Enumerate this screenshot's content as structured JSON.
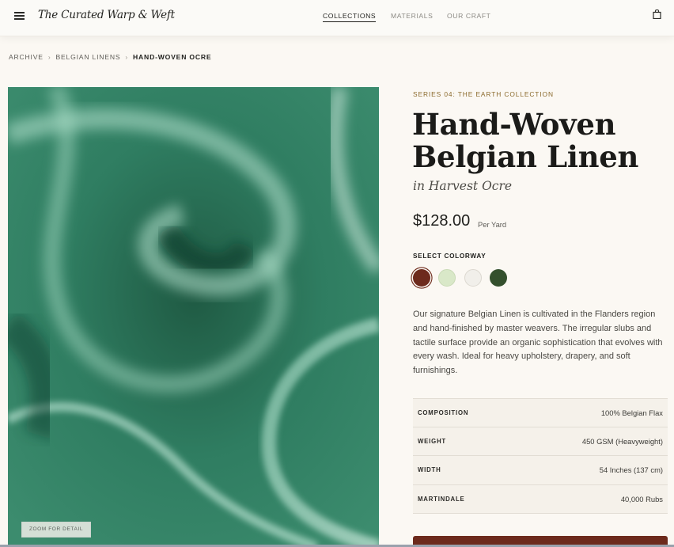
{
  "header": {
    "brand": "The Curated Warp & Weft",
    "nav": [
      {
        "label": "COLLECTIONS",
        "active": true
      },
      {
        "label": "MATERIALS",
        "active": false
      },
      {
        "label": "OUR CRAFT",
        "active": false
      }
    ],
    "icons": {
      "menu": "hamburger-icon",
      "cart": "shopping-bag-icon"
    }
  },
  "breadcrumb": {
    "items": [
      "ARCHIVE",
      "BELGIAN LINENS",
      "HAND-WOVEN OCRE"
    ],
    "separator": "›"
  },
  "gallery": {
    "image_description": "close-up of draped green silky fabric",
    "zoom_label": "ZOOM FOR DETAIL"
  },
  "product": {
    "series": "SERIES 04: THE EARTH COLLECTION",
    "title_line1": "Hand-Woven",
    "title_line2": "Belgian Linen",
    "subtitle": "in Harvest Ocre",
    "price": "$128.00",
    "price_unit": "Per Yard",
    "colorway_label": "SELECT COLORWAY",
    "colorways": [
      {
        "color": "#6d2a1c",
        "selected": true
      },
      {
        "color": "#d9e8c8",
        "selected": false
      },
      {
        "color": "#f1efea",
        "selected": false
      },
      {
        "color": "#34502d",
        "selected": false
      }
    ],
    "description": "Our signature Belgian Linen is cultivated in the Flanders region and hand-finished by master weavers. The irregular slubs and tactile surface provide an organic sophistication that evolves with every wash. Ideal for heavy upholstery, drapery, and soft furnishings.",
    "specs": [
      {
        "label": "COMPOSITION",
        "value": "100% Belgian Flax"
      },
      {
        "label": "WEIGHT",
        "value": "450 GSM (Heavyweight)"
      },
      {
        "label": "WIDTH",
        "value": "54 Inches (137 cm)"
      },
      {
        "label": "MARTINDALE",
        "value": "40,000 Rubs"
      }
    ],
    "cta_color": "#6d2a1c"
  }
}
